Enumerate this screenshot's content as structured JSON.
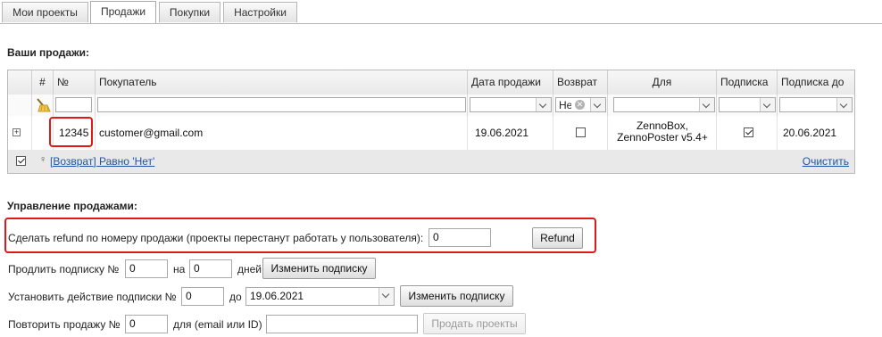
{
  "tabs": [
    "Мои проекты",
    "Продажи",
    "Покупки",
    "Настройки"
  ],
  "sales": {
    "heading": "Ваши продажи:",
    "columns": [
      "#",
      "№",
      "Покупатель",
      "Дата продажи",
      "Возврат",
      "Для",
      "Подписка",
      "Подписка до"
    ],
    "filter_refund_value": "Не",
    "row": {
      "number": "12345",
      "customer": "customer@gmail.com",
      "date": "19.06.2021",
      "refund_checked": false,
      "for_line1": "ZennoBox,",
      "for_line2": "ZennoPoster v5.4+",
      "subscription_checked": true,
      "subscription_until": "20.06.2021"
    },
    "filter_text": "[Возврат] Равно 'Нет'",
    "clear_label": "Очистить"
  },
  "management": {
    "heading": "Управление продажами:",
    "refund_label": "Сделать refund по номеру продажи (проекты перестанут работать у пользователя):",
    "refund_value": "0",
    "refund_button": "Refund",
    "extend_label": "Продлить подписку №",
    "extend_number": "0",
    "extend_on_label": "на",
    "extend_days": "0",
    "extend_days_label": "дней",
    "change_button": "Изменить подписку",
    "set_label": "Установить действие подписки №",
    "set_number": "0",
    "set_until_label": "до",
    "set_date": "19.06.2021",
    "repeat_label": "Повторить продажу №",
    "repeat_number": "0",
    "repeat_for_label": "для (email или ID)",
    "repeat_target": "",
    "sell_button": "Продать проекты"
  }
}
